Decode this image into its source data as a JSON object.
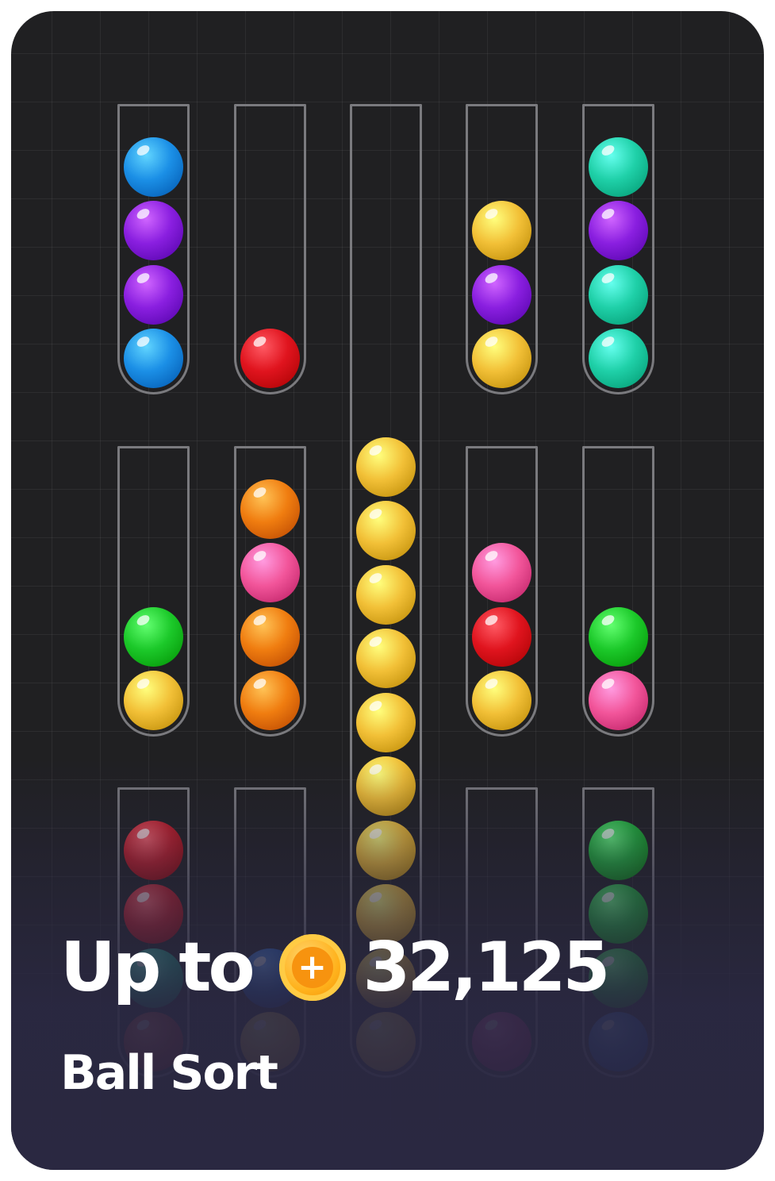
{
  "card": {
    "reward_prefix": "Up to",
    "coin_symbol": "+",
    "reward_amount": "32,125",
    "game_title": "Ball Sort"
  },
  "palette": {
    "blue": "#1b8fe6",
    "purple": "#8a1fe0",
    "red": "#e0141e",
    "yellow": "#f2c037",
    "teal": "#1fd0a8",
    "green": "#1cc92a",
    "orange": "#f07d10",
    "pink": "#f2559a",
    "darkred": "#c91d28",
    "darkgreen": "#1fb83a",
    "navy": "#1f63c8",
    "tealfaded": "#1fa888",
    "brownred": "#c0392b",
    "magenta": "#c7277d"
  },
  "tubes": [
    {
      "id": "tube-1",
      "balls": [
        "blue",
        "purple",
        "purple",
        "blue"
      ]
    },
    {
      "id": "tube-2",
      "balls": [
        "red"
      ]
    },
    {
      "id": "tube-3-tall",
      "balls": [
        "yellow",
        "yellow",
        "yellow",
        "yellow",
        "yellow",
        "yellow",
        "yellow",
        "yellow",
        "yellow",
        "yellow"
      ]
    },
    {
      "id": "tube-4",
      "balls": [
        "yellow",
        "purple",
        "yellow"
      ]
    },
    {
      "id": "tube-5",
      "balls": [
        "teal",
        "purple",
        "teal",
        "teal"
      ]
    },
    {
      "id": "tube-6",
      "balls": [
        "green",
        "yellow"
      ]
    },
    {
      "id": "tube-7",
      "balls": [
        "orange",
        "pink",
        "orange",
        "orange"
      ]
    },
    {
      "id": "tube-8",
      "balls": [
        "pink",
        "red",
        "yellow"
      ]
    },
    {
      "id": "tube-9",
      "balls": [
        "green",
        "pink"
      ]
    },
    {
      "id": "tube-10",
      "balls": [
        "darkred",
        "darkred",
        "tealfaded",
        "brownred"
      ]
    },
    {
      "id": "tube-11",
      "balls": [
        "navy",
        "yellow"
      ]
    },
    {
      "id": "tube-12",
      "balls": [
        "magenta"
      ]
    },
    {
      "id": "tube-13",
      "balls": [
        "darkgreen",
        "darkgreen",
        "darkgreen",
        "navy"
      ]
    }
  ]
}
